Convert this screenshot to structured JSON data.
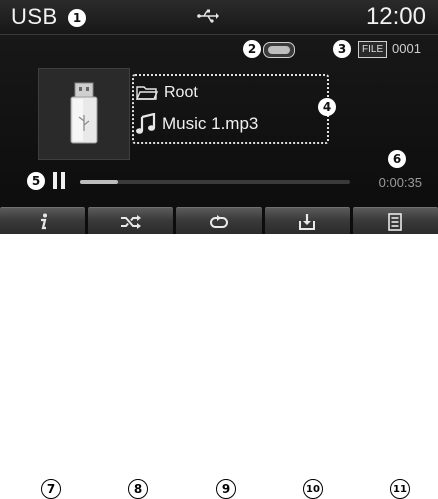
{
  "header": {
    "source": "USB",
    "time": "12:00"
  },
  "status": {
    "file_label": "FILE",
    "file_number": "0001"
  },
  "track": {
    "folder": "Root",
    "song": "Music 1.mp3",
    "elapsed": "0:00:35",
    "progress_fraction": 0.14
  },
  "callouts": {
    "c1": "1",
    "c2": "2",
    "c3": "3",
    "c4": "4",
    "c5": "5",
    "c6": "6",
    "c7": "7",
    "c8": "8",
    "c9": "9",
    "c10": "10",
    "c11": "11"
  },
  "buttons": [
    {
      "icon": "info-icon"
    },
    {
      "icon": "shuffle-icon"
    },
    {
      "icon": "repeat-icon"
    },
    {
      "icon": "download-icon"
    },
    {
      "icon": "list-icon"
    }
  ],
  "colors": {
    "screen": "#111111",
    "text": "#f0f0f0",
    "muted": "#9a9a9a",
    "button": "#4a4a4a"
  }
}
